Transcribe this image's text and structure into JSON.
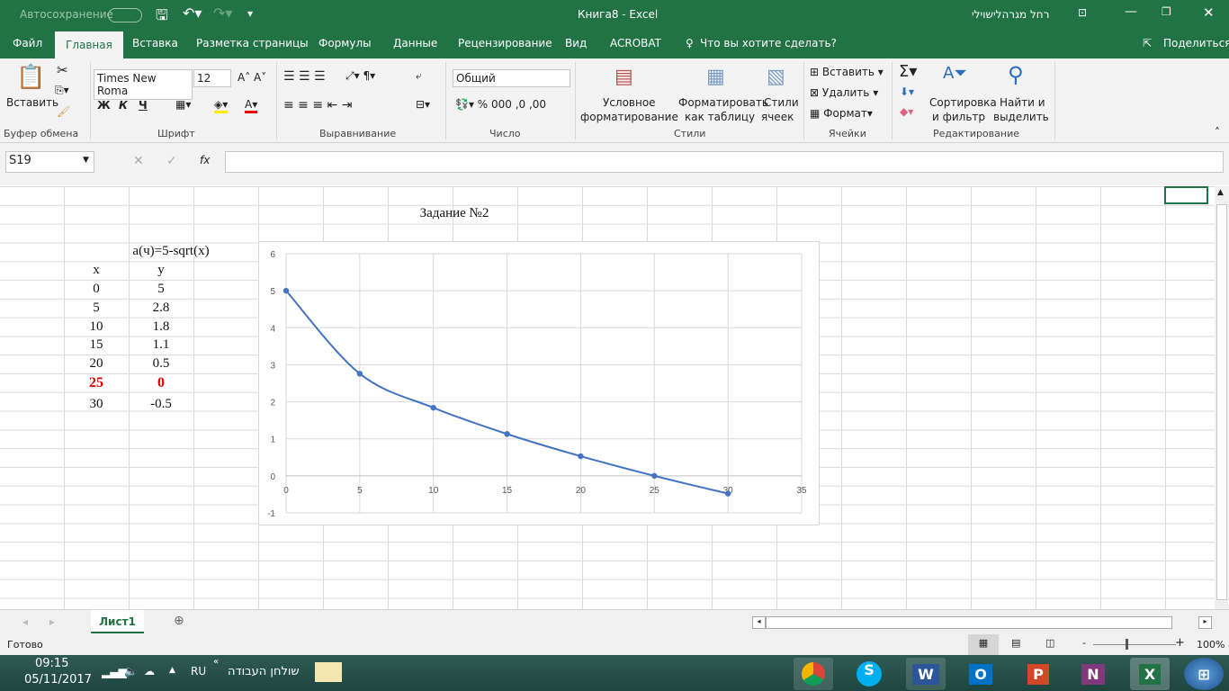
{
  "titlebar": {
    "autosave": "Автосохранение",
    "title": "Книга8  -  Excel",
    "user": "רחל מגרהלישוילי"
  },
  "tabs": [
    "Файл",
    "Главная",
    "Вставка",
    "Разметка страницы",
    "Формулы",
    "Данные",
    "Рецензирование",
    "Вид",
    "ACROBAT"
  ],
  "tell_me": "Что вы хотите сделать?",
  "share": "Поделиться",
  "ribbon": {
    "paste": "Вставить",
    "font_name": "Times New Roma",
    "font_size": "12",
    "bold": "Ж",
    "italic": "К",
    "underline": "Ч",
    "number_format": "Общий",
    "cond_format": [
      "Условное",
      "форматирование"
    ],
    "format_table": [
      "Форматировать",
      "как таблицу"
    ],
    "cell_styles": [
      "Стили",
      "ячеек"
    ],
    "insert": "Вставить",
    "delete": "Удалить",
    "format": "Формат",
    "sort": [
      "Сортировка",
      "и фильтр"
    ],
    "find": [
      "Найти и",
      "выделить"
    ],
    "groups": [
      "Буфер обмена",
      "Шрифт",
      "Выравнивание",
      "Число",
      "Стили",
      "Ячейки",
      "Редактирование"
    ]
  },
  "formula_bar": {
    "name_box": "S19",
    "formula": "",
    "fx": "fx"
  },
  "sheet": {
    "title": "Задание №2",
    "formula_label": "а(ч)=5-sqrt(x)",
    "col_x": "x",
    "col_y": "y",
    "rows": [
      {
        "x": "0",
        "y": "5"
      },
      {
        "x": "5",
        "y": "2.8"
      },
      {
        "x": "10",
        "y": "1.8"
      },
      {
        "x": "15",
        "y": "1.1"
      },
      {
        "x": "20",
        "y": "0.5"
      },
      {
        "x": "25",
        "y": "0",
        "highlight": true
      },
      {
        "x": "30",
        "y": "-0.5"
      }
    ]
  },
  "chart_data": {
    "type": "scatter",
    "title": "",
    "xlabel": "",
    "ylabel": "",
    "xlim": [
      0,
      35
    ],
    "ylim": [
      -1,
      6
    ],
    "xticks": [
      "0",
      "5",
      "10",
      "15",
      "20",
      "25",
      "30",
      "35"
    ],
    "yticks": [
      "-1",
      "0",
      "1",
      "2",
      "3",
      "4",
      "5",
      "6"
    ],
    "series": [
      {
        "name": "y",
        "color": "#4472c4",
        "smooth": true,
        "x": [
          0,
          5,
          10,
          15,
          20,
          25,
          30
        ],
        "y": [
          5,
          2.76,
          1.84,
          1.13,
          0.53,
          0,
          -0.48
        ]
      }
    ],
    "grid": true
  },
  "sheet_tab": "Лист1",
  "status": "Готово",
  "zoom": "100%",
  "taskbar": {
    "time": "09:15",
    "date": "05/11/2017",
    "lang": "RU",
    "desktop": "שולחן העבודה"
  }
}
